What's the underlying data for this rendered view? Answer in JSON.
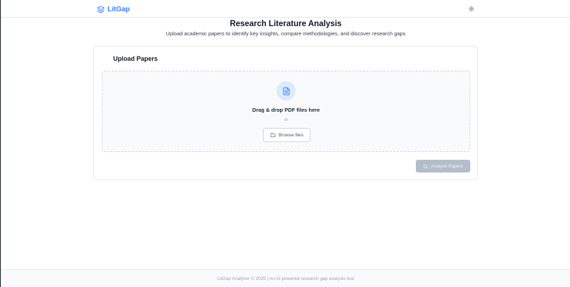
{
  "header": {
    "brand": "LitGap",
    "brand_icon": "layers-icon",
    "theme_icon": "sun-icon"
  },
  "main": {
    "title": "Research Literature Analysis",
    "subtitle": "Upload academic papers to identify key insights, compare methodologies, and discover research gaps"
  },
  "upload": {
    "card_title": "Upload Papers",
    "file_icon": "file-text-icon",
    "drop_text": "Drag & drop PDF files here",
    "or_text": "or",
    "browse_label": "Browse files",
    "browse_icon": "folder-icon",
    "analyze_label": "Analyze Papers",
    "analyze_icon": "search-icon"
  },
  "footer": {
    "text": "LitGap Analyzer © 2025 | An AI-powered research gap analysis tool"
  },
  "colors": {
    "accent": "#3b82f6",
    "accent_light": "#dbeafe",
    "disabled_button": "#b4bdc9"
  }
}
